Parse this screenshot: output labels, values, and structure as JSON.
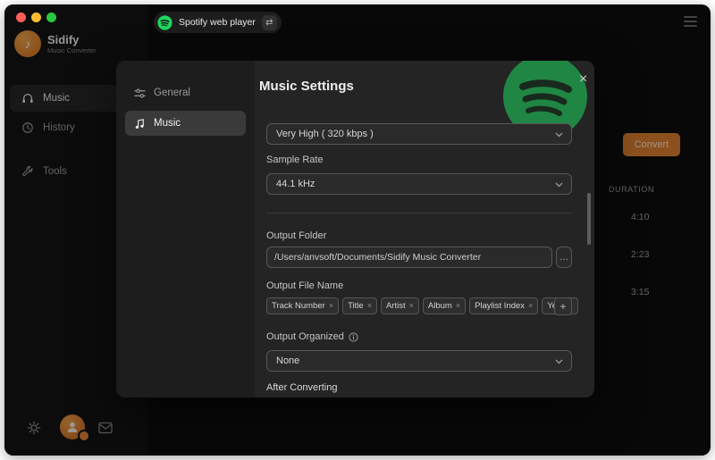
{
  "titlebar": {
    "source": "Spotify web player",
    "swap_glyph": "⇄"
  },
  "sidebar": {
    "app_name": "Sidify",
    "app_tagline": "Music Converter",
    "items": [
      {
        "label": "Music",
        "active": true
      },
      {
        "label": "History",
        "active": false
      },
      {
        "label": "Tools",
        "active": false
      }
    ]
  },
  "main": {
    "convert_label": "Convert",
    "duration_header": "DURATION",
    "durations": [
      "4:10",
      "2:23",
      "3:15"
    ]
  },
  "modal": {
    "title": "Music Settings",
    "close_glyph": "×",
    "nav": [
      {
        "label": "General",
        "active": false
      },
      {
        "label": "Music",
        "active": true
      }
    ],
    "bitrate_value": "Very High ( 320 kbps )",
    "sample_rate_label": "Sample Rate",
    "sample_rate_value": "44.1 kHz",
    "output_folder_label": "Output Folder",
    "output_folder_value": "/Users/anvsoft/Documents/Sidify Music Converter",
    "browse_label": "…",
    "output_file_name_label": "Output File Name",
    "tags": [
      {
        "label": "Track Number"
      },
      {
        "label": "Title"
      },
      {
        "label": "Artist"
      },
      {
        "label": "Album"
      },
      {
        "label": "Playlist Index"
      },
      {
        "label": "Year"
      }
    ],
    "remove_glyph": "×",
    "add_label": "+",
    "output_organized_label": "Output Organized",
    "output_organized_value": "None",
    "after_converting_label": "After Converting"
  },
  "colors": {
    "accent_orange": "#e0812f",
    "spotify_green": "#1ed760",
    "window_bg": "#0d0d0d",
    "modal_bg": "#242424"
  }
}
